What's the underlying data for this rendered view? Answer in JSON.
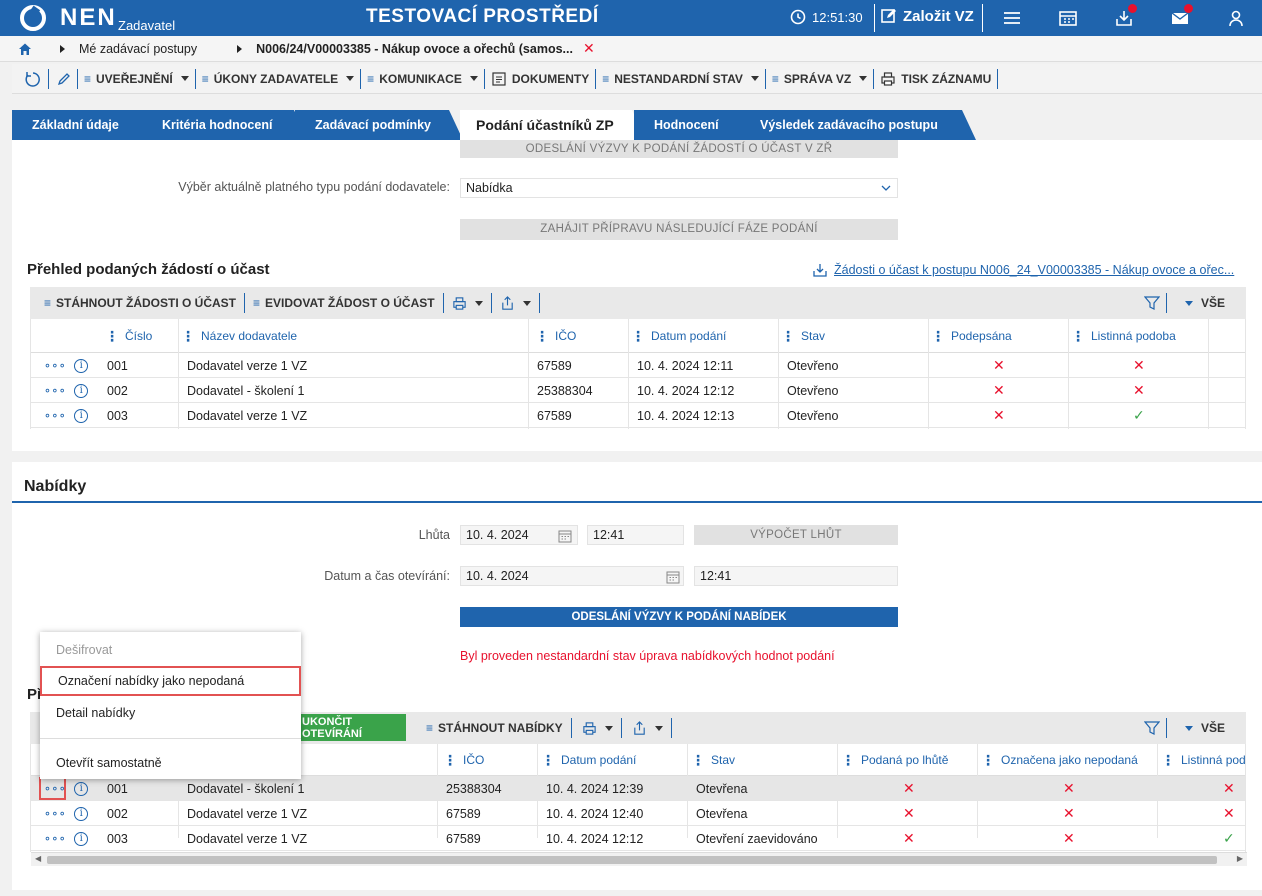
{
  "header": {
    "logo_text": "NEN",
    "logo_sub": "Zadavatel",
    "environment": "TESTOVACÍ PROSTŘEDÍ",
    "clock": "12:51:30",
    "create_label": "Založit VZ"
  },
  "breadcrumb": {
    "items": [
      "Mé zadávací postupy",
      "N006/24/V00003385 - Nákup ovoce a ořechů (samos..."
    ]
  },
  "toolbar": {
    "items": [
      "UVEŘEJNĚNÍ",
      "ÚKONY ZADAVATELE",
      "KOMUNIKACE",
      "DOKUMENTY",
      "NESTANDARDNÍ STAV",
      "SPRÁVA VZ",
      "TISK ZÁZNAMU"
    ]
  },
  "tabs": [
    "Základní údaje",
    "Kritéria hodnocení",
    "Zadávací podmínky",
    "Podání účastníků ZP",
    "Hodnocení",
    "Výsledek zadávacího postupu"
  ],
  "top_section": {
    "btn_send_invites": "ODESLÁNÍ VÝZVY K PODÁNÍ ŽÁDOSTÍ O ÚČAST V ZŘ",
    "type_label": "Výběr aktuálně platného typu podání dodavatele:",
    "type_value": "Nabídka",
    "btn_next_phase": "ZAHÁJIT PŘÍPRAVU NÁSLEDUJÍCÍ FÁZE PODÁNÍ"
  },
  "requests": {
    "title": "Přehled podaných žádostí o účast",
    "link": "Žádosti o účast k postupu N006_24_V00003385 - Nákup ovoce a ořec...",
    "actions": [
      "STÁHNOUT ŽÁDOSTI O ÚČAST",
      "EVIDOVAT ŽÁDOST O ÚČAST"
    ],
    "filter_all": "VŠE",
    "columns": [
      "Číslo",
      "Název dodavatele",
      "IČO",
      "Datum podání",
      "Stav",
      "Podepsána",
      "Listinná podoba"
    ],
    "rows": [
      {
        "num": "001",
        "supplier": "Dodavatel verze 1 VZ",
        "ico": "67589",
        "date": "10. 4. 2024 12:11",
        "status": "Otevřeno",
        "signed": "x",
        "paper": "x"
      },
      {
        "num": "002",
        "supplier": "Dodavatel - školení 1",
        "ico": "25388304",
        "date": "10. 4. 2024 12:12",
        "status": "Otevřeno",
        "signed": "x",
        "paper": "x"
      },
      {
        "num": "003",
        "supplier": "Dodavatel verze 1 VZ",
        "ico": "67589",
        "date": "10. 4. 2024 12:13",
        "status": "Otevřeno",
        "signed": "x",
        "paper": "check"
      }
    ]
  },
  "offers": {
    "title": "Nabídky",
    "deadline_label": "Lhůta",
    "deadline_date": "10. 4. 2024",
    "deadline_time": "12:41",
    "btn_calc": "VÝPOČET LHŮT",
    "opening_label": "Datum a čas otevírání:",
    "opening_date": "10. 4. 2024",
    "opening_time": "12:41",
    "btn_send": "ODESLÁNÍ VÝZVY K PODÁNÍ NABÍDEK",
    "warning": "Byl proveden nestandardní stav úprava nabídkových hodnot podání",
    "section_prefix": "Př",
    "btn_finish_opening": "UKONČIT OTEVÍRÁNÍ",
    "btn_download": "STÁHNOUT NABÍDKY",
    "filter_all": "VŠE",
    "columns": [
      "IČO",
      "Datum podání",
      "Stav",
      "Podaná po lhůtě",
      "Označena jako nepodaná",
      "Listinná pod"
    ],
    "rows": [
      {
        "num": "001",
        "supplier": "Dodavatel - školení 1",
        "ico": "25388304",
        "date": "10. 4. 2024 12:39",
        "status": "Otevřena",
        "late": "x",
        "unsubmitted": "x",
        "paper": "x"
      },
      {
        "num": "002",
        "supplier": "Dodavatel verze 1 VZ",
        "ico": "67589",
        "date": "10. 4. 2024 12:40",
        "status": "Otevřena",
        "late": "x",
        "unsubmitted": "x",
        "paper": "x"
      },
      {
        "num": "003",
        "supplier": "Dodavatel verze 1 VZ",
        "ico": "67589",
        "date": "10. 4. 2024 12:12",
        "status": "Otevření zaevidováno",
        "late": "x",
        "unsubmitted": "x",
        "paper": "check"
      }
    ]
  },
  "context_menu": {
    "items": [
      "Dešifrovat",
      "Označení nabídky jako nepodaná",
      "Detail nabídky",
      "Otevřít samostatně"
    ]
  },
  "colors": {
    "brand": "#1f64ad",
    "error": "#e8112d",
    "success": "#3aa34a"
  }
}
